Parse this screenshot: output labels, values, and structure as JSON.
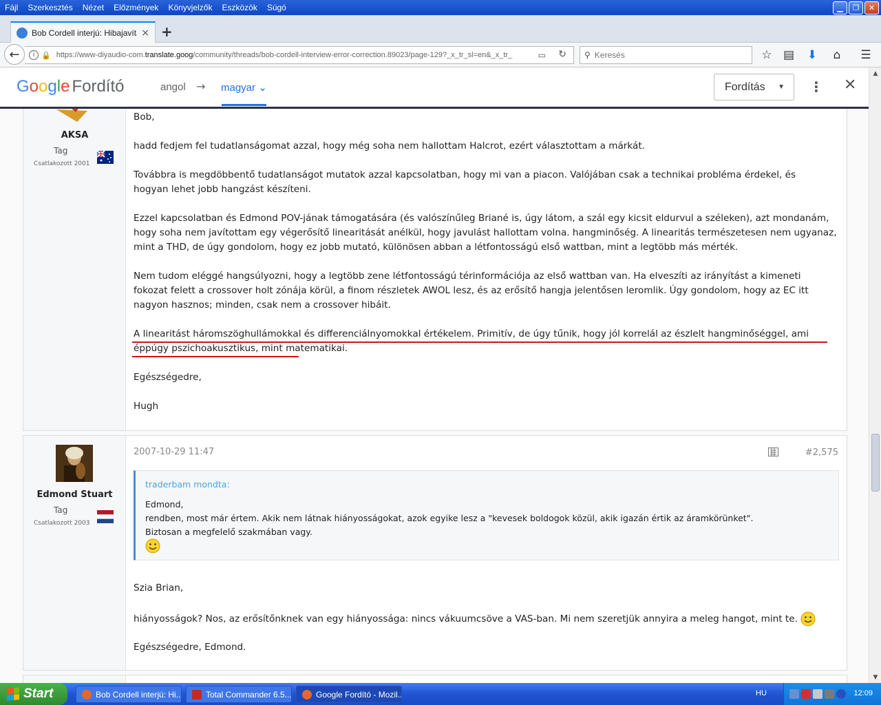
{
  "menubar": {
    "items": [
      "Fájl",
      "Szerkesztés",
      "Nézet",
      "Előzmények",
      "Könyvjelzők",
      "Eszközök",
      "Súgó"
    ]
  },
  "tab": {
    "title": "Bob Cordell interjú: Hibajavítá...",
    "close": "×",
    "new": "+"
  },
  "navbar": {
    "url_prefix": "https://www-diyaudio-com.",
    "url_host": "translate.goog",
    "url_rest": "/community/threads/bob-cordell-interview-error-correction.89023/page-129?_x_tr_sl=en&_x_tr_",
    "search_placeholder": "Keresés"
  },
  "translate_bar": {
    "logo_letters": [
      "G",
      "o",
      "o",
      "g",
      "l",
      "e"
    ],
    "product": "Fordító",
    "source_lang": "angol",
    "arrow": "→",
    "target_lang": "magyar",
    "target_caret": "⌄",
    "translate_button": "Fordítás",
    "more": "⋮",
    "close": "✕"
  },
  "post1": {
    "username": "AKSA",
    "title": "Tag",
    "joined": "Csatlakozott 2001",
    "paragraphs": [
      "Bob,",
      "hadd fedjem fel tudatlanságomat azzal, hogy még soha nem hallottam Halcrot, ezért választottam a márkát.",
      "Továbbra is megdöbbentő tudatlanságot mutatok azzal kapcsolatban, hogy mi van a piacon. Valójában csak a technikai probléma érdekel, és hogyan lehet jobb hangzást készíteni.",
      "Ezzel kapcsolatban és Edmond POV-jának támogatására (és valószínűleg Briané is, úgy látom, a szál egy kicsit eldurvul a széleken), azt mondanám, hogy soha nem javítottam egy végerősítő linearitását anélkül, hogy javulást hallottam volna. hangminőség. A linearitás természetesen nem ugyanaz, mint a THD, de úgy gondolom, hogy ez jobb mutató, különösen abban a létfontosságú első wattban, mint a legtöbb más mérték.",
      "Nem tudom eléggé hangsúlyozni, hogy a legtöbb zene létfontosságú térinformációja az első wattban van. Ha elveszíti az irányítást a kimeneti fokozat felett a crossover holt zónája körül, a finom részletek AWOL lesz, és az erősítő hangja jelentősen leromlik. Úgy gondolom, hogy az EC itt nagyon hasznos; minden, csak nem a crossover hibáit.",
      "A linearitást háromszöghullámokkal és differenciálnyomokkal értékelem. Primitív, de úgy tűnik, hogy jól korrelál az észlelt hangminőséggel, ami éppúgy pszichoakusztikus, mint matematikai.",
      "Egészségedre,",
      "Hugh"
    ]
  },
  "post2": {
    "username": "Edmond Stuart",
    "title": "Tag",
    "joined": "Csatlakozott 2003",
    "date": "2007-10-29 11:47",
    "post_number": "#2,575",
    "quote_author": "traderbam mondta:",
    "quote_lines": [
      "Edmond,",
      "rendben, most már értem. Akik nem látnak hiányosságokat, azok egyike lesz a \"kevesek boldogok közül, akik igazán értik az áramkörünket\".",
      "Biztosan a megfelelő szakmában vagy."
    ],
    "p1": "Szia Brian,",
    "p2": "hiányosságok? Nos, az erősítőnknek van egy hiányossága: nincs vákuumcsöve a VAS-ban. Mi nem szeretjük annyira a meleg hangot, mint te.",
    "p3": "Egészségedre, Edmond."
  },
  "taskbar": {
    "start": "Start",
    "tasks": [
      "Bob Cordell interjú: Hi...",
      "Total Commander 6.5...",
      "Google Fordító - Mozil..."
    ],
    "lang": "HU",
    "clock": "12:09"
  }
}
